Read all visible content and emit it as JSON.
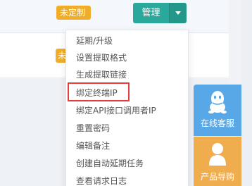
{
  "table": {
    "row1_status": "未定制",
    "row2_status": "未"
  },
  "manage_button": {
    "label": "管理"
  },
  "dropdown": {
    "items": [
      "延期/升级",
      "设置提取格式",
      "生成提取链接",
      "绑定终端IP",
      "绑定API接口调用者IP",
      "重置密码",
      "编辑备注",
      "创建自动延期任务",
      "查看请求日志"
    ],
    "highlighted_item": "绑定终端IP"
  },
  "side_widget": {
    "customer_service_label": "在线客服",
    "product_guide_label": "产品导购"
  },
  "colors": {
    "accent_teal": "#2aa89b",
    "badge_orange": "#f0ad2a",
    "highlight_red": "#e53d3d",
    "customer_service_blue": "#58a8e8",
    "guide_orange": "#f0ad4e"
  }
}
